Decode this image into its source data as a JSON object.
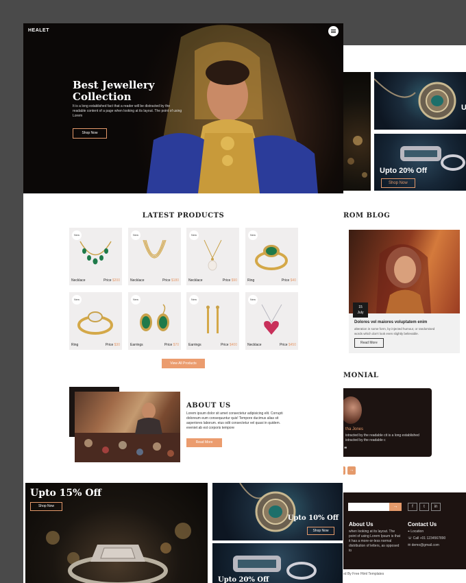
{
  "brand": {
    "logo": "HEALET",
    "accent": "#e59a6b"
  },
  "hero": {
    "title_line1": "Best Jewellery",
    "title_line2": "Collection",
    "text": "It is a long established fact that a reader will be distracted by the readable content of a page when looking at its layout. The point of using Lorem",
    "button": "Shop Now"
  },
  "products": {
    "title": "LATEST PRODUCTS",
    "badge": "New",
    "price_label": "Price",
    "items": [
      {
        "name": "Necklace",
        "price": "$200",
        "icon": "emerald-necklace-icon"
      },
      {
        "name": "Necklace",
        "price": "$180",
        "icon": "gold-chain-icon"
      },
      {
        "name": "Necklace",
        "price": "$90",
        "icon": "pearl-pendant-icon"
      },
      {
        "name": "Ring",
        "price": "$40",
        "icon": "emerald-ring-icon"
      },
      {
        "name": "Ring",
        "price": "$30",
        "icon": "diamond-ring-icon"
      },
      {
        "name": "Earrings",
        "price": "$70",
        "icon": "emerald-earrings-icon"
      },
      {
        "name": "Earrings",
        "price": "$400",
        "icon": "gold-earrings-icon"
      },
      {
        "name": "Necklace",
        "price": "$450",
        "icon": "heart-pendant-icon"
      }
    ],
    "view_all": "View All Products"
  },
  "about": {
    "title": "ABOUT US",
    "text": "Lorem ipsum dolor sit amet consectetur adipisicing elit. Corrupti doloreum eum consequuntur quis! Tempore ducimus alias sit asperiores laborum. eius odit consectetur vel quasi in quidem. eveniet ab est corporis tempore",
    "button": "Read More"
  },
  "promos": {
    "big_title": "Upto 15% Off",
    "big_button": "Shop Now",
    "right1_title": "Upto 10% Off",
    "right1_button": "Shop Now",
    "right2_title": "Upto 20% Off"
  },
  "back_page": {
    "top_label_fragment": "U",
    "promo_title": "Upto 20% Off",
    "promo_button": "Shop Now",
    "blog_heading": "ROM BLOG",
    "blog_day": "15",
    "blog_month": "July",
    "blog_title": "Dolores vel maiores voluptatem enim",
    "blog_text": "alteration in some form, by injected humour, or randomised words which don't look even slightly believable.",
    "blog_button": "Read More",
    "testimonial_heading": "MONIAL",
    "testimonial_name": "tha Jones",
    "testimonial_text": "istracted by the readable cit is a long established istracted by the readable c",
    "quote": "❝",
    "pager_prev": "←",
    "pager_next": "→",
    "send_icon": "→",
    "social": [
      "f",
      "t",
      "in"
    ],
    "about_heading": "About Us",
    "about_text": "when looking at its layout. The point of using Lorem Ipsum is that it has a more-or-less normal distribution of letters, as opposed to",
    "contact_heading": "Contact Us",
    "contact_location": "Location",
    "contact_phone": "Call +01 1234567890",
    "contact_email": "demo@gmail.com",
    "copyright": "ed By Free Html Templates"
  }
}
